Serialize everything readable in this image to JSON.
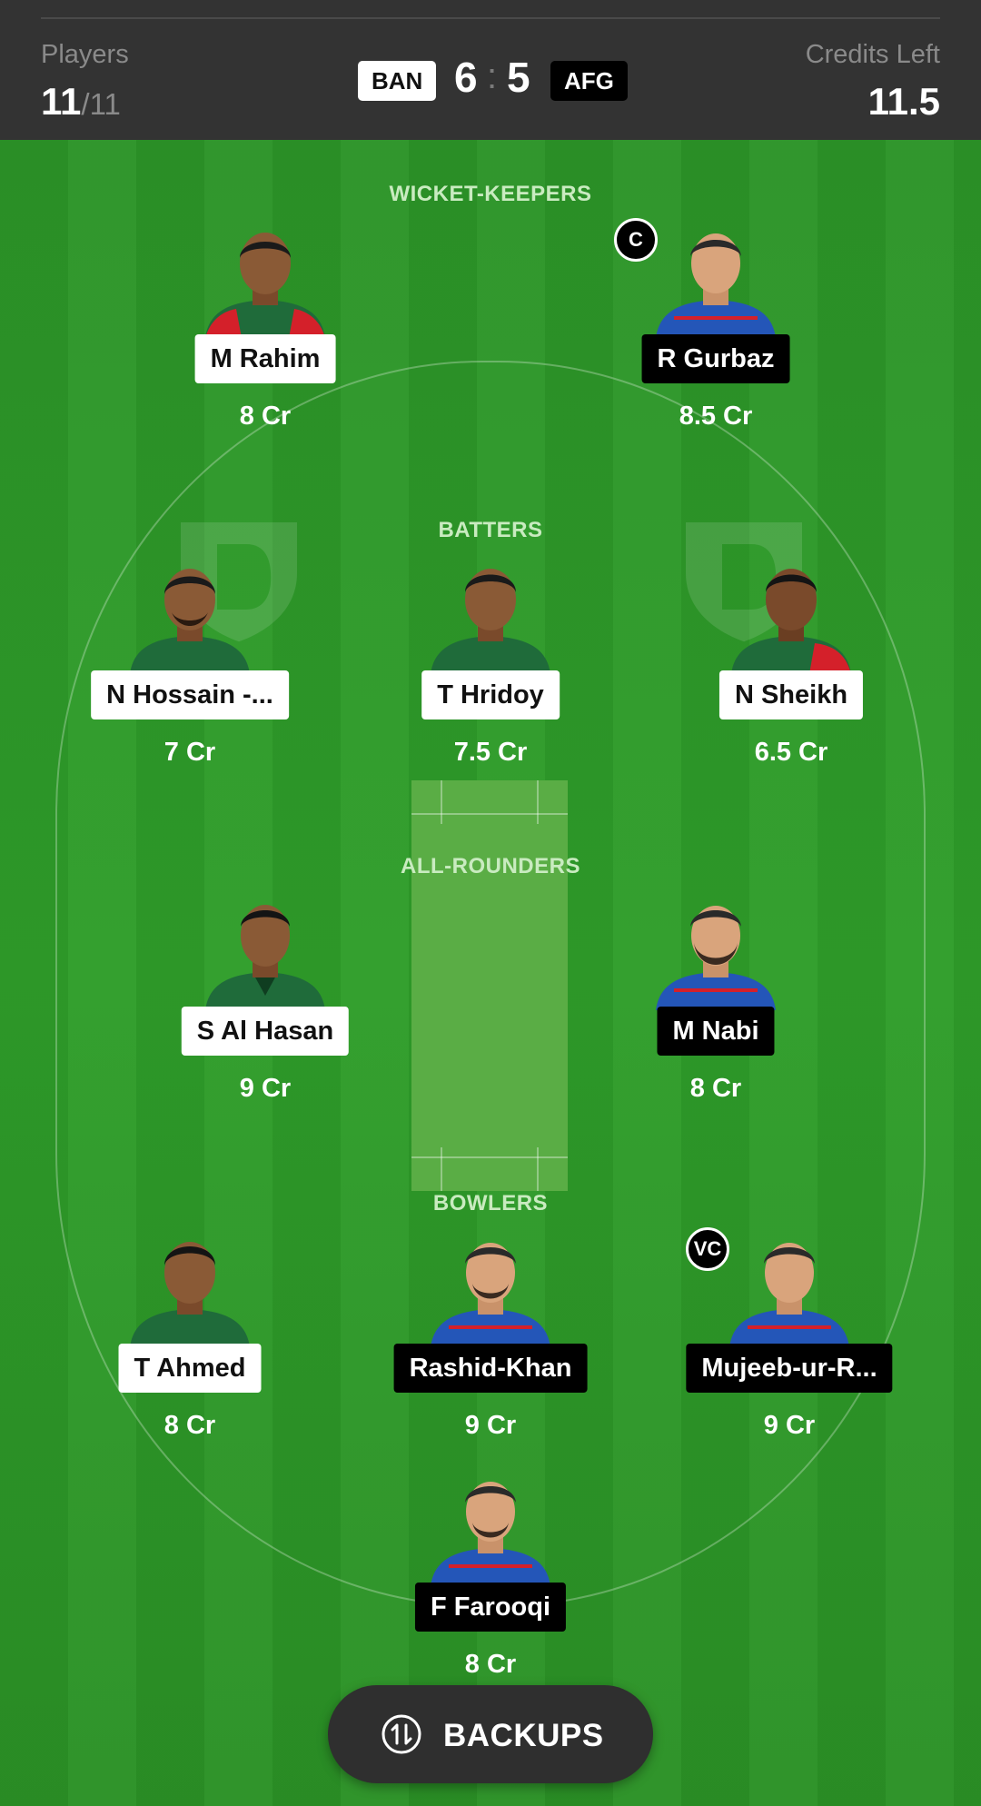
{
  "header": {
    "players_label": "Players",
    "players_count": "11",
    "players_total": "/11",
    "team_left": "BAN",
    "score_left": "6",
    "score_sep": ":",
    "score_right": "5",
    "team_right": "AFG",
    "credits_label": "Credits Left",
    "credits_value": "11.5"
  },
  "sections": {
    "wicket_keepers": "WICKET-KEEPERS",
    "batters": "BATTERS",
    "all_rounders": "ALL-ROUNDERS",
    "bowlers": "BOWLERS"
  },
  "players": {
    "m_rahim": {
      "name": "M Rahim",
      "credit": "8 Cr",
      "team": "BAN"
    },
    "r_gurbaz": {
      "name": "R Gurbaz",
      "credit": "8.5 Cr",
      "team": "AFG",
      "badge": "C"
    },
    "n_hossain": {
      "name": "N Hossain -...",
      "credit": "7 Cr",
      "team": "BAN"
    },
    "t_hridoy": {
      "name": "T Hridoy",
      "credit": "7.5 Cr",
      "team": "BAN"
    },
    "n_sheikh": {
      "name": "N Sheikh",
      "credit": "6.5 Cr",
      "team": "BAN"
    },
    "s_al_hasan": {
      "name": "S Al Hasan",
      "credit": "9 Cr",
      "team": "BAN"
    },
    "m_nabi": {
      "name": "M Nabi",
      "credit": "8 Cr",
      "team": "AFG"
    },
    "t_ahmed": {
      "name": "T Ahmed",
      "credit": "8 Cr",
      "team": "BAN"
    },
    "rashid_khan": {
      "name": "Rashid-Khan",
      "credit": "9 Cr",
      "team": "AFG"
    },
    "mujeeb": {
      "name": "Mujeeb-ur-R...",
      "credit": "9 Cr",
      "team": "AFG",
      "badge": "VC"
    },
    "f_farooqi": {
      "name": "F Farooqi",
      "credit": "8 Cr",
      "team": "AFG"
    }
  },
  "backups_button": {
    "label": "BACKUPS",
    "icon": "swap-updown-icon"
  },
  "colors": {
    "header_bg": "#333333",
    "pitch_green": "#2f9e2a",
    "ban_jersey": "#1f6b3a",
    "ban_accent": "#d4202a",
    "afg_jersey": "#2456b8"
  }
}
